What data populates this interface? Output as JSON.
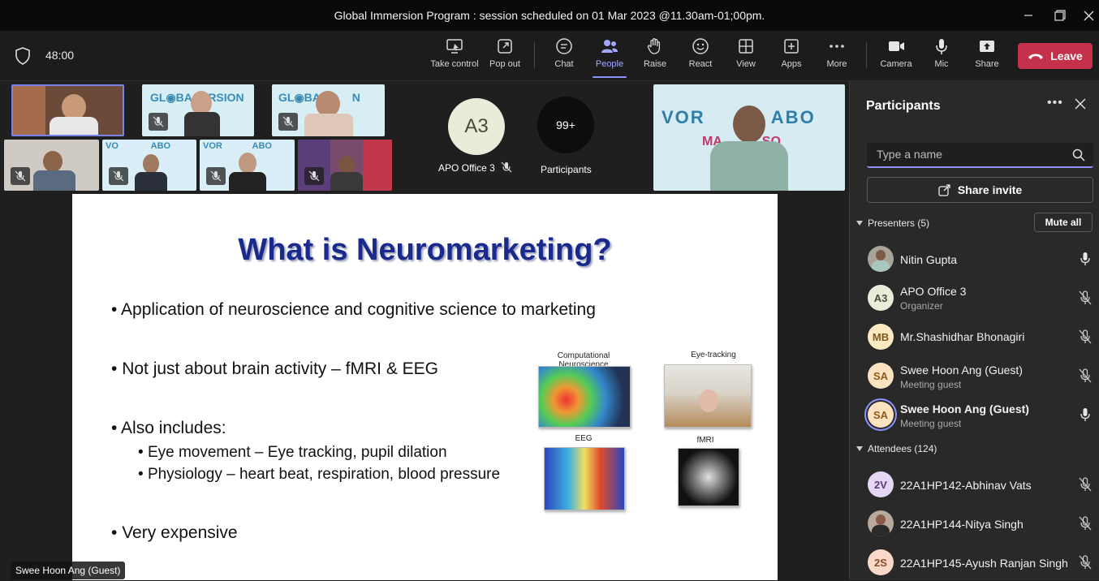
{
  "window": {
    "title": "Global Immersion Program : session scheduled on 01 Mar 2023 @11.30am-01;00pm."
  },
  "toolbar": {
    "timer": "48:00",
    "buttons": [
      {
        "label": "Take control",
        "icon": "take-control-icon"
      },
      {
        "label": "Pop out",
        "icon": "pop-out-icon"
      },
      {
        "label": "Chat",
        "icon": "chat-icon"
      },
      {
        "label": "People",
        "icon": "people-icon",
        "active": true
      },
      {
        "label": "Raise",
        "icon": "raise-hand-icon"
      },
      {
        "label": "React",
        "icon": "react-icon"
      },
      {
        "label": "View",
        "icon": "view-icon"
      },
      {
        "label": "Apps",
        "icon": "apps-icon"
      },
      {
        "label": "More",
        "icon": "more-icon"
      },
      {
        "label": "Camera",
        "icon": "camera-icon"
      },
      {
        "label": "Mic",
        "icon": "mic-icon"
      },
      {
        "label": "Share",
        "icon": "share-icon"
      }
    ],
    "leave_label": "Leave"
  },
  "stage": {
    "organizer_initials": "A3",
    "organizer_name": "APO Office 3",
    "participants_count": "99+",
    "participants_label": "Participants",
    "presenter_nameplate": "Swee Hoon Ang (Guest)"
  },
  "slide": {
    "title": "What is Neuromarketing?",
    "bullets": [
      "Application of neuroscience and cognitive science to marketing",
      "Not just about brain activity – fMRI & EEG",
      "Also includes:",
      "Very expensive"
    ],
    "subbullets": [
      "Eye movement – Eye tracking, pupil dilation",
      "Physiology – heart beat, respiration, blood pressure"
    ],
    "figures": [
      "Computational Neuroscience",
      "Eye-tracking",
      "EEG",
      "fMRI"
    ]
  },
  "panel": {
    "title": "Participants",
    "search_placeholder": "Type a name",
    "share_invite": "Share invite",
    "presenters_label": "Presenters (5)",
    "mute_all": "Mute all",
    "attendees_label": "Attendees (124)",
    "presenters": [
      {
        "name": "Nitin Gupta",
        "role": "",
        "initials": "",
        "mic": "on"
      },
      {
        "name": "APO Office 3",
        "role": "Organizer",
        "initials": "A3",
        "mic": "off"
      },
      {
        "name": "Mr.Shashidhar Bhonagiri",
        "role": "",
        "initials": "MB",
        "mic": "off"
      },
      {
        "name": "Swee Hoon Ang (Guest)",
        "role": "Meeting guest",
        "initials": "SA",
        "mic": "off"
      },
      {
        "name": "Swee Hoon Ang (Guest)",
        "role": "Meeting guest",
        "initials": "SA",
        "mic": "on"
      }
    ],
    "attendees": [
      {
        "name": "22A1HP142-Abhinav Vats",
        "initials": "2V",
        "mic": "off"
      },
      {
        "name": "22A1HP144-Nitya Singh",
        "initials": "",
        "mic": "off"
      },
      {
        "name": "22A1HP145-Ayush Ranjan Singh",
        "initials": "2S",
        "mic": "off"
      }
    ]
  },
  "colors": {
    "accent": "#8c92ff",
    "leave": "#c4314b",
    "slide_title": "#1a2a8c"
  }
}
